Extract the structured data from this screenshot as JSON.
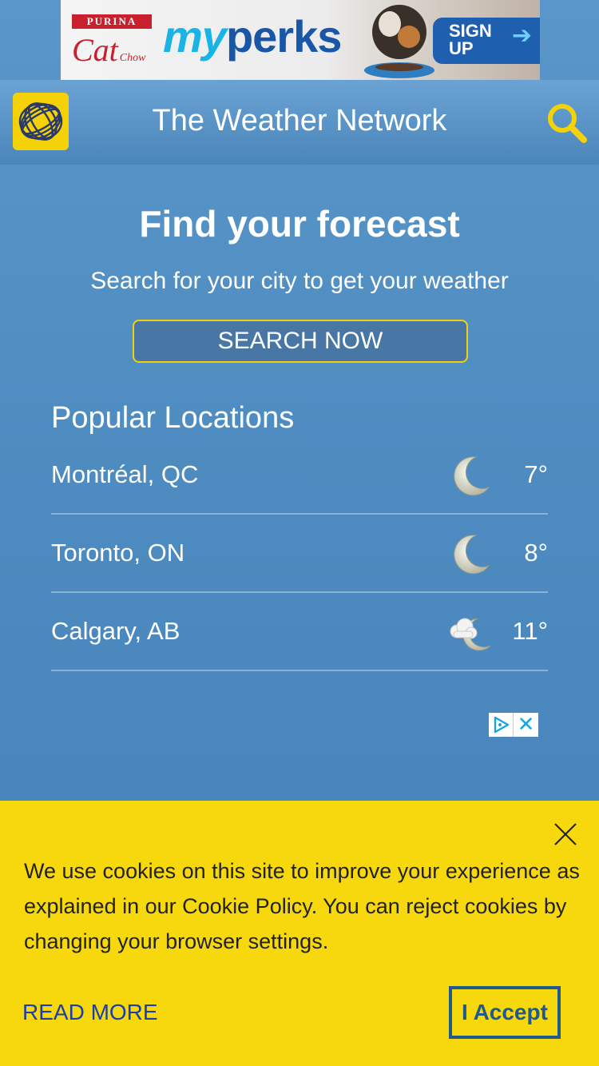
{
  "banner_ad": {
    "brand": "PURINA",
    "product": "Cat",
    "product_sub": "Chow",
    "headline_prefix": "my",
    "headline": "perks",
    "cta_line1": "SIGN",
    "cta_line2": "UP",
    "cta_icon": "arrow-right-icon"
  },
  "header": {
    "logo_icon": "weather-network-globe-logo",
    "title": "The Weather Network",
    "search_icon": "search-icon",
    "accent_color": "#f5d208"
  },
  "hero": {
    "title": "Find your forecast",
    "subtitle": "Search for your city to get your weather",
    "search_button": "SEARCH NOW"
  },
  "popular": {
    "heading": "Popular Locations",
    "locations": [
      {
        "name": "Montréal, QC",
        "icon": "moon-icon",
        "temp": "7°"
      },
      {
        "name": "Toronto, ON",
        "icon": "moon-icon",
        "temp": "8°"
      },
      {
        "name": "Calgary, AB",
        "icon": "cloudy-night-icon",
        "temp": "11°"
      }
    ]
  },
  "ad_choices": {
    "play_icon": "adchoices-icon",
    "close_icon": "close-icon"
  },
  "cookie_banner": {
    "text": "We use cookies on this site to improve your experience as explained in our Cookie Policy. You can reject cookies by changing your browser settings.",
    "read_more": "READ MORE",
    "accept": "I Accept",
    "close_icon": "close-icon",
    "background_color": "#f6d80c"
  }
}
